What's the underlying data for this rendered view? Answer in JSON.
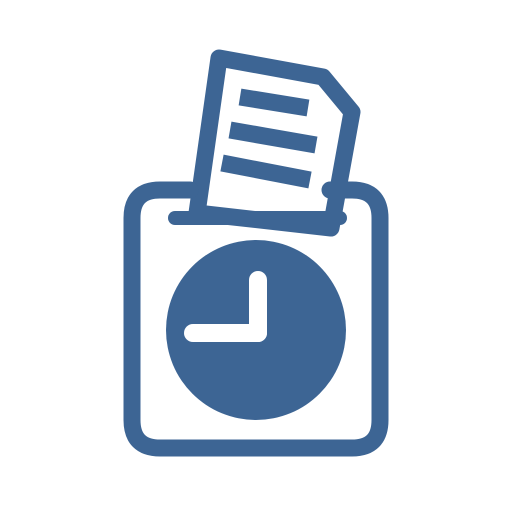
{
  "icon": {
    "name": "time-clock-card-icon",
    "colors": {
      "primary": "#3d6594",
      "background": "#ffffff"
    }
  }
}
